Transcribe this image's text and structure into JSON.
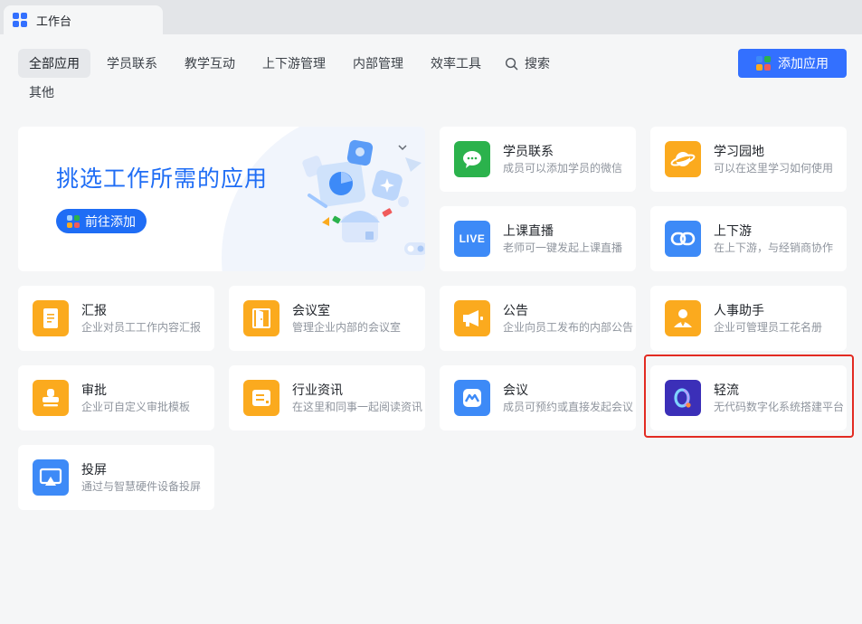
{
  "window": {
    "tab_title": "工作台"
  },
  "nav": {
    "items": [
      "全部应用",
      "学员联系",
      "教学互动",
      "上下游管理",
      "内部管理",
      "效率工具"
    ],
    "search_label": "搜索",
    "row2": [
      "其他"
    ],
    "active_index": 0
  },
  "add_button": {
    "label": "添加应用"
  },
  "banner": {
    "title": "挑选工作所需的应用",
    "button_label": "前往添加"
  },
  "apps": [
    {
      "title": "学员联系",
      "desc": "成员可以添加学员的微信",
      "icon": "wechat-chat-icon",
      "color": "#2bb24c"
    },
    {
      "title": "学习园地",
      "desc": "可以在这里学习如何使用",
      "icon": "planet-icon",
      "color": "#fbaa1e"
    },
    {
      "title": "上课直播",
      "desc": "老师可一键发起上课直播",
      "icon": "live-icon",
      "color": "#3d8af7",
      "icon_text": "LIVE"
    },
    {
      "title": "上下游",
      "desc": "在上下游，与经销商协作",
      "icon": "link-chain-icon",
      "color": "#3d8af7"
    },
    {
      "title": "汇报",
      "desc": "企业对员工工作内容汇报",
      "icon": "report-doc-icon",
      "color": "#fbaa1e"
    },
    {
      "title": "会议室",
      "desc": "管理企业内部的会议室",
      "icon": "door-icon",
      "color": "#fbaa1e"
    },
    {
      "title": "公告",
      "desc": "企业向员工发布的内部公告",
      "icon": "megaphone-icon",
      "color": "#fbaa1e"
    },
    {
      "title": "人事助手",
      "desc": "企业可管理员工花名册",
      "icon": "person-icon",
      "color": "#fbaa1e"
    },
    {
      "title": "审批",
      "desc": "企业可自定义审批模板",
      "icon": "stamp-icon",
      "color": "#fbaa1e"
    },
    {
      "title": "行业资讯",
      "desc": "在这里和同事一起阅读资讯",
      "icon": "news-icon",
      "color": "#fbaa1e"
    },
    {
      "title": "会议",
      "desc": "成员可预约或直接发起会议",
      "icon": "meeting-icon",
      "color": "#3d8af7"
    },
    {
      "title": "轻流",
      "desc": "无代码数字化系统搭建平台",
      "icon": "qingflow-logo-icon",
      "color": "#3b2fb8"
    },
    {
      "title": "投屏",
      "desc": "通过与智慧硬件设备投屏",
      "icon": "screen-cast-icon",
      "color": "#3d8af7"
    }
  ],
  "colors": {
    "accent": "#3370ff",
    "brand_grid": [
      "#3d8af7",
      "#2bb24c",
      "#fbaa1e",
      "#f05b5b"
    ],
    "highlight": "#e22b22"
  }
}
